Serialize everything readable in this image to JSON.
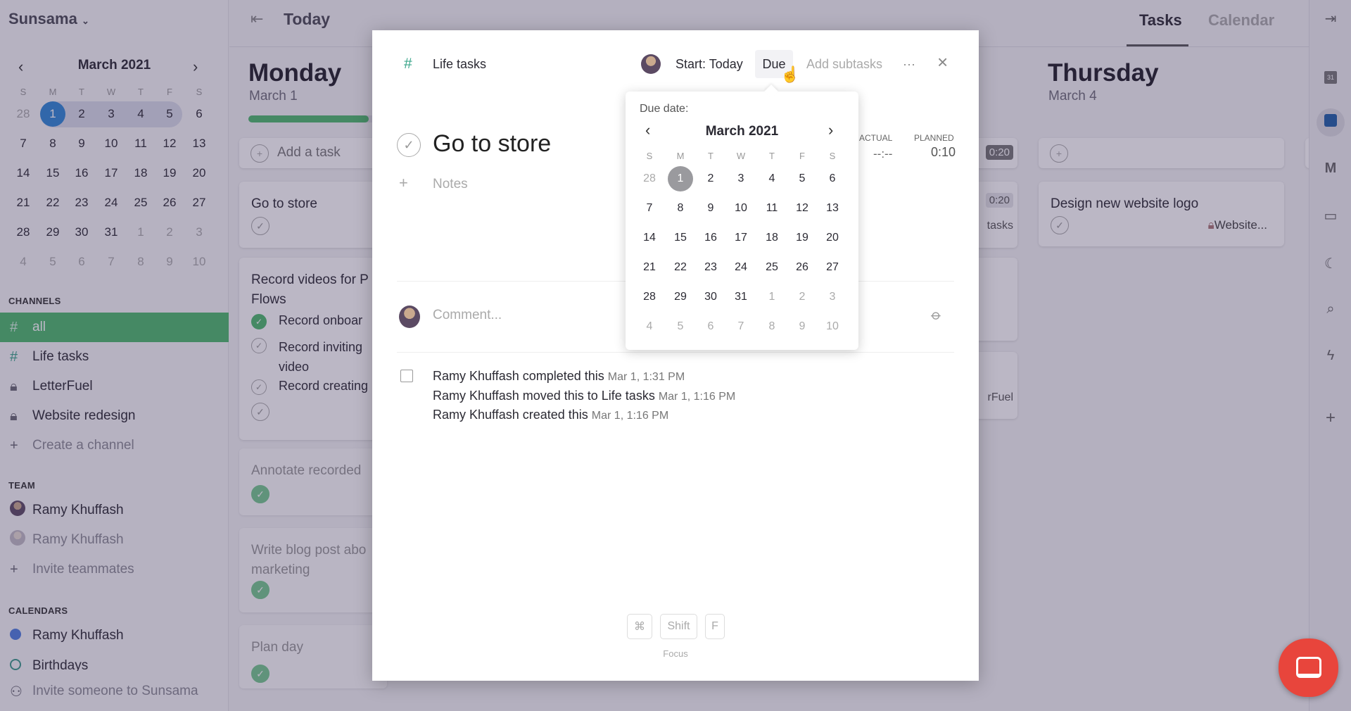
{
  "app": {
    "name": "Sunsama"
  },
  "colors": {
    "accent_green": "#4cba6d",
    "selected_day": "#2e86d6",
    "calendar_dot": "#4e7fe0",
    "intercom": "#e8453c"
  },
  "mini_calendar": {
    "title": "March 2021",
    "weekdays": [
      "S",
      "M",
      "T",
      "W",
      "T",
      "F",
      "S"
    ],
    "selected": "1",
    "weeks": [
      [
        "28",
        "1",
        "2",
        "3",
        "4",
        "5",
        "6"
      ],
      [
        "7",
        "8",
        "9",
        "10",
        "11",
        "12",
        "13"
      ],
      [
        "14",
        "15",
        "16",
        "17",
        "18",
        "19",
        "20"
      ],
      [
        "21",
        "22",
        "23",
        "24",
        "25",
        "26",
        "27"
      ],
      [
        "28",
        "29",
        "30",
        "31",
        "1",
        "2",
        "3"
      ],
      [
        "4",
        "5",
        "6",
        "7",
        "8",
        "9",
        "10"
      ]
    ],
    "dim": [
      [
        0
      ],
      [],
      [],
      [],
      [
        4,
        5,
        6
      ],
      [
        0,
        1,
        2,
        3,
        4,
        5,
        6
      ]
    ]
  },
  "sidebar": {
    "channels_label": "CHANNELS",
    "channels": [
      {
        "icon": "hash-icon",
        "label": "all",
        "active": true
      },
      {
        "icon": "hash-icon",
        "label": "Life tasks"
      },
      {
        "icon": "lock-icon",
        "label": "LetterFuel"
      },
      {
        "icon": "lock-icon",
        "label": "Website redesign"
      },
      {
        "icon": "plus-icon",
        "label": "Create a channel",
        "muted": true
      }
    ],
    "team_label": "TEAM",
    "team": [
      {
        "label": "Ramy Khuffash"
      },
      {
        "label": "Ramy Khuffash",
        "muted": true
      },
      {
        "label": "Invite teammates",
        "muted": true
      }
    ],
    "calendars_label": "CALENDARS",
    "calendars": [
      {
        "label": "Ramy Khuffash"
      },
      {
        "label": "Birthdays"
      }
    ],
    "invite_label": "Invite someone to Sunsama"
  },
  "header": {
    "title": "Today",
    "tabs": [
      {
        "label": "Tasks",
        "active": true
      },
      {
        "label": "Calendar"
      }
    ]
  },
  "monday": {
    "title": "Monday",
    "date": "March 1",
    "progress": 0.9,
    "add_task": "Add a task",
    "cards": [
      {
        "title": "Go to store"
      },
      {
        "title": "Record videos for P",
        "title2": "Flows",
        "subtasks": [
          {
            "label": "Record onboar",
            "done": true
          },
          {
            "label": "Record inviting",
            "label2": "video"
          },
          {
            "label": "Record creating"
          }
        ]
      },
      {
        "title": "Annotate recorded",
        "done": true
      },
      {
        "title": "Write blog post abo",
        "title2": "marketing",
        "done": true
      },
      {
        "title": "Plan day",
        "done": true
      }
    ]
  },
  "middle": {
    "badge1": "0:20",
    "badge2": "0:20",
    "channel1": "tasks",
    "channel2": "rFuel"
  },
  "thursday": {
    "title": "Thursday",
    "date": "March 4",
    "cards": [
      {
        "title": "Design new website logo",
        "channel": "Website..."
      }
    ]
  },
  "modal": {
    "channel": "Life tasks",
    "start": "Start: Today",
    "due": "Due",
    "add_subtasks": "Add subtasks",
    "more": "···",
    "close": "×",
    "title": "Go to store",
    "notes_placeholder": "Notes",
    "actual_label": "ACTUAL",
    "actual_value": "--:--",
    "planned_label": "PLANNED",
    "planned_value": "0:10",
    "comment_placeholder": "Comment...",
    "activity": [
      {
        "text": "Ramy Khuffash completed this",
        "time": "Mar 1, 1:31 PM"
      },
      {
        "text": "Ramy Khuffash moved this to Life tasks",
        "time": "Mar 1, 1:16 PM"
      },
      {
        "text": "Ramy Khuffash created this",
        "time": "Mar 1, 1:16 PM"
      }
    ],
    "keys": [
      "⌘",
      "Shift",
      "F"
    ],
    "keys_label": "Focus",
    "due_picker": {
      "label": "Due date:",
      "title": "March 2021",
      "selected": "1"
    }
  }
}
